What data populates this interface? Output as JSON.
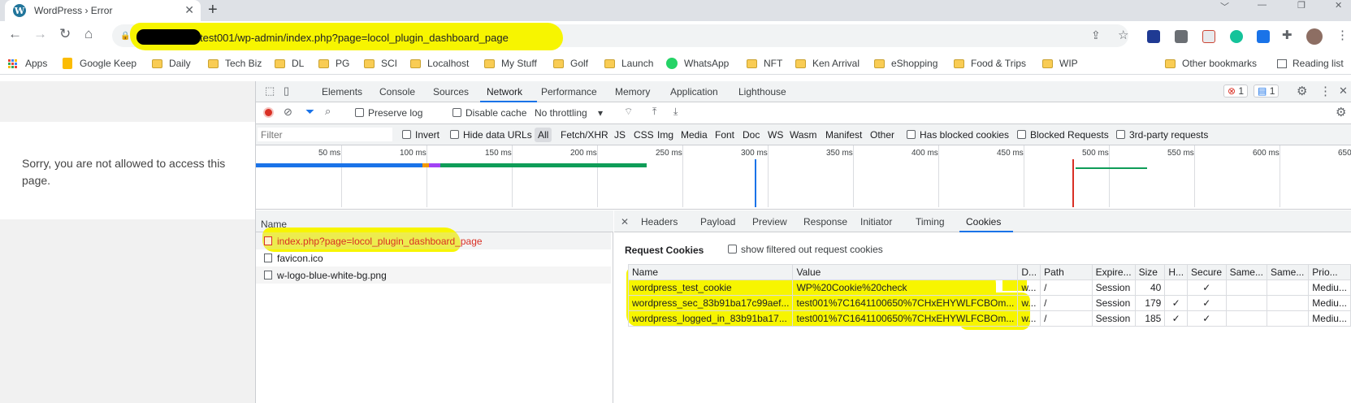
{
  "browser": {
    "tab_title": "WordPress › Error",
    "close_tab_glyph": "✕",
    "new_tab_glyph": "+",
    "window_controls": [
      "﹀",
      "—",
      "❐",
      "✕"
    ],
    "url": "test001/wp-admin/index.php?page=locol_plugin_dashboard_page",
    "url_redacted": true,
    "highlight_color": "#f7f500"
  },
  "bookmarks": [
    {
      "label": "Apps",
      "icon": "apps-grid-icon"
    },
    {
      "label": "Google Keep",
      "icon": "keep-icon"
    },
    {
      "label": "Daily",
      "icon": "folder-icon"
    },
    {
      "label": "Tech Biz",
      "icon": "folder-icon"
    },
    {
      "label": "DL",
      "icon": "folder-icon"
    },
    {
      "label": "PG",
      "icon": "folder-icon"
    },
    {
      "label": "SCI",
      "icon": "folder-icon"
    },
    {
      "label": "Localhost",
      "icon": "folder-icon"
    },
    {
      "label": "My Stuff",
      "icon": "folder-icon"
    },
    {
      "label": "Golf",
      "icon": "folder-icon"
    },
    {
      "label": "Launch",
      "icon": "folder-icon"
    },
    {
      "label": "WhatsApp",
      "icon": "whatsapp-icon"
    },
    {
      "label": "NFT",
      "icon": "folder-icon"
    },
    {
      "label": "Ken Arrival",
      "icon": "folder-icon"
    },
    {
      "label": "eShopping",
      "icon": "folder-icon"
    },
    {
      "label": "Food & Trips",
      "icon": "folder-icon"
    },
    {
      "label": "WIP",
      "icon": "folder-icon"
    }
  ],
  "other_bookmarks": "Other bookmarks",
  "reading_list": "Reading list",
  "page": {
    "message": "Sorry, you are not allowed to access this page."
  },
  "devtools": {
    "tabs": [
      "Elements",
      "Console",
      "Sources",
      "Network",
      "Performance",
      "Memory",
      "Application",
      "Lighthouse"
    ],
    "active_tab": "Network",
    "errors_badge": "1",
    "messages_badge": "1",
    "toolbar": {
      "preserve_log": "Preserve log",
      "disable_cache": "Disable cache",
      "throttling": "No throttling"
    },
    "filter_bar": {
      "placeholder": "Filter",
      "invert": "Invert",
      "hide_data_urls": "Hide data URLs",
      "types": [
        "All",
        "Fetch/XHR",
        "JS",
        "CSS",
        "Img",
        "Media",
        "Font",
        "Doc",
        "WS",
        "Wasm",
        "Manifest",
        "Other"
      ],
      "has_blocked_cookies": "Has blocked cookies",
      "blocked_requests": "Blocked Requests",
      "third_party": "3rd-party requests"
    },
    "timeline_ticks": [
      "50 ms",
      "100 ms",
      "150 ms",
      "200 ms",
      "250 ms",
      "300 ms",
      "350 ms",
      "400 ms",
      "450 ms",
      "500 ms",
      "550 ms",
      "600 ms",
      "650"
    ],
    "requests_header": "Name",
    "requests": [
      {
        "name": "index.php?page=locol_plugin_dashboard_page",
        "selected": true,
        "error": true
      },
      {
        "name": "favicon.ico",
        "selected": false,
        "error": false
      },
      {
        "name": "w-logo-blue-white-bg.png",
        "selected": false,
        "error": false
      }
    ],
    "detail_tabs": [
      "Headers",
      "Payload",
      "Preview",
      "Response",
      "Initiator",
      "Timing",
      "Cookies"
    ],
    "detail_active": "Cookies",
    "detail_close": "✕",
    "cookies": {
      "section_title": "Request Cookies",
      "show_filtered": "show filtered out request cookies",
      "columns": [
        "Name",
        "Value",
        "D...",
        "Path",
        "Expire...",
        "Size",
        "H...",
        "Secure",
        "Same...",
        "Same...",
        "Prio..."
      ],
      "rows": [
        [
          "wordpress_test_cookie",
          "WP%20Cookie%20check",
          "w...",
          "/",
          "Session",
          "40",
          "",
          "✓",
          "",
          "",
          "Mediu..."
        ],
        [
          "wordpress_sec_83b91ba17c99aef...",
          "test001%7C1641100650%7CHxEHYWLFCBOm...",
          "w...",
          "/",
          "Session",
          "179",
          "✓",
          "✓",
          "",
          "",
          "Mediu..."
        ],
        [
          "wordpress_logged_in_83b91ba17...",
          "test001%7C1641100650%7CHxEHYWLFCBOm...",
          "w...",
          "/",
          "Session",
          "185",
          "✓",
          "✓",
          "",
          "",
          "Mediu..."
        ]
      ]
    }
  }
}
